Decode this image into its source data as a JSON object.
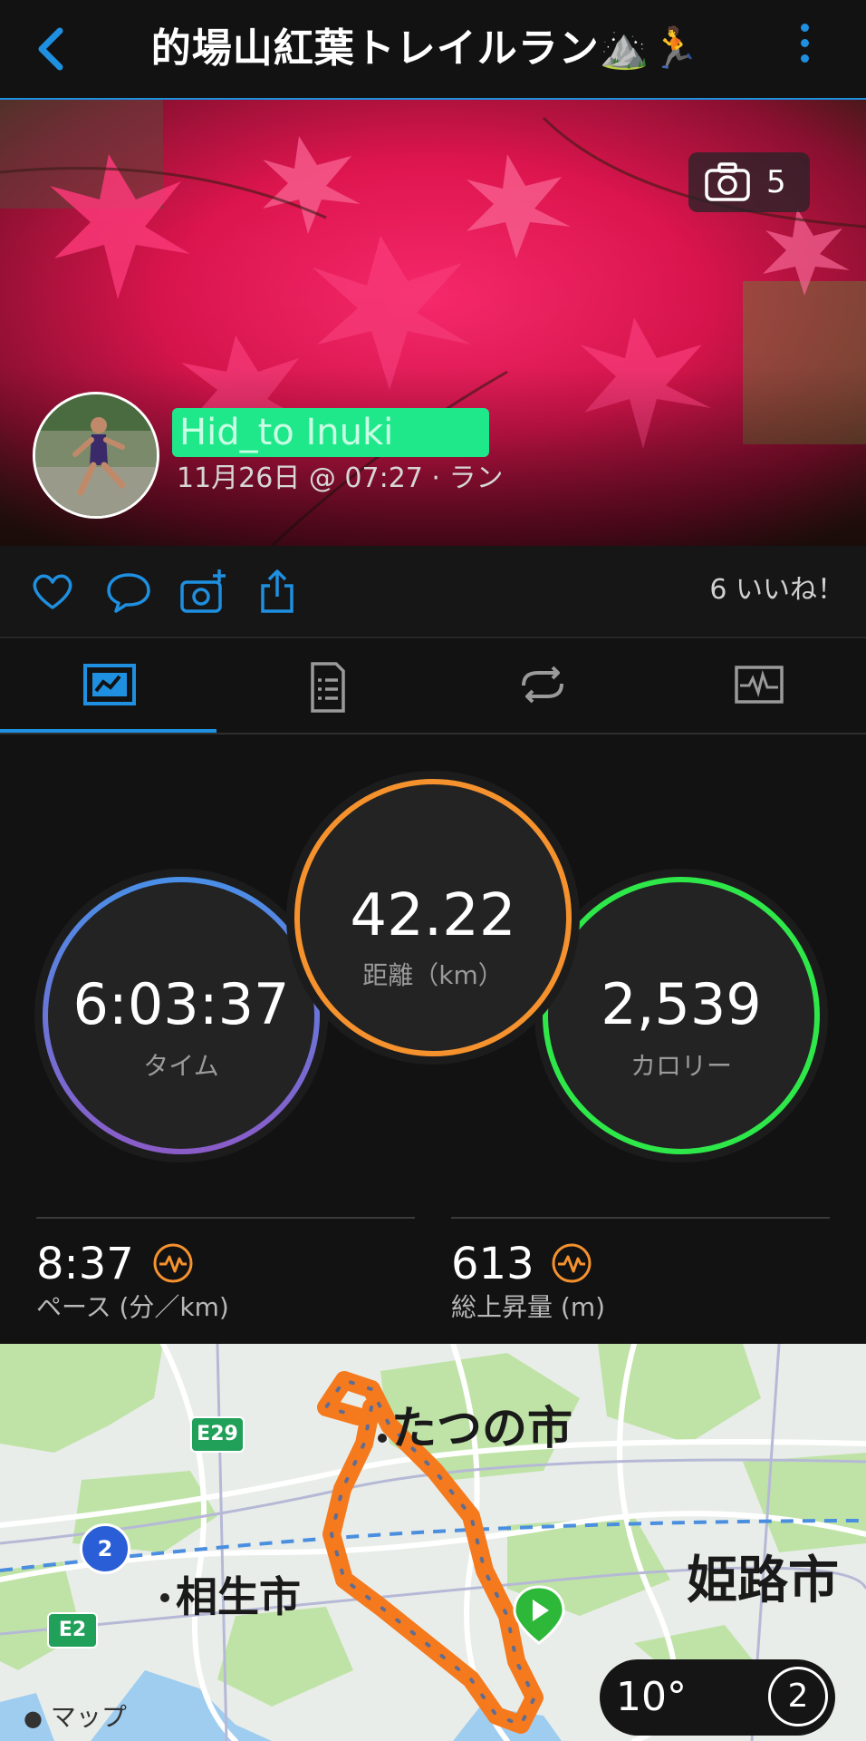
{
  "header": {
    "title": "的場山紅葉トレイルラン⛰️🏃"
  },
  "hero": {
    "photo_count": "5",
    "user_name": "Hid_to Inuki",
    "activity_meta": "11月26日 @ 07:27 · ラン"
  },
  "actions": {
    "likes_label": "6 いいね！"
  },
  "tabs": [
    {
      "name": "overview"
    },
    {
      "name": "details"
    },
    {
      "name": "laps"
    },
    {
      "name": "charts"
    }
  ],
  "metrics": {
    "time": {
      "value": "6:03:37",
      "label": "タイム"
    },
    "distance": {
      "value": "42.22",
      "label": "距離（km）"
    },
    "calories": {
      "value": "2,539",
      "label": "カロリー"
    }
  },
  "stats": {
    "pace": {
      "value": "8:37",
      "label": "ペース (分／km)"
    },
    "elevation": {
      "value": "613",
      "label": "総上昇量 (m)"
    }
  },
  "map": {
    "city_tatsuno": "たつの市",
    "city_aioi": "相生市",
    "city_himeji": "姫路市",
    "route_e29": "E29",
    "route_2": "2",
    "route_e2": "E2",
    "attribution": "マップ",
    "weather_temp": "10°",
    "weather_num": "2"
  },
  "colors": {
    "accent": "#1f8fe0",
    "time_ring_top": "#4a8fe8",
    "time_ring_bottom": "#8a5cc8",
    "distance_ring": "#f5922e",
    "calories_ring": "#2ee84a",
    "route": "#f57a1e",
    "user_highlight": "#1fe88a"
  }
}
